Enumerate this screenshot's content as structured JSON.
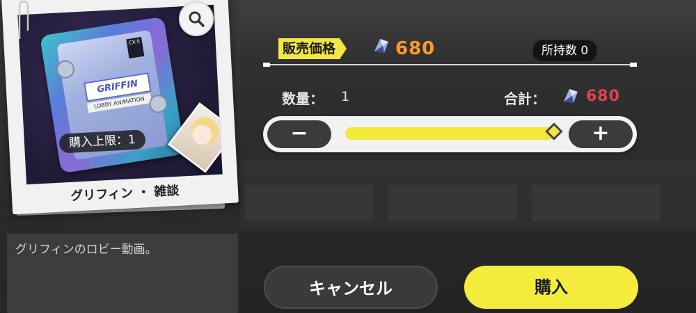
{
  "item": {
    "purchase_limit": "購入上限：1",
    "name": "グリフィン ・ 雑談",
    "description": "グリフィンのロビー動画。",
    "device_label": "GRIFFIN",
    "device_sublabel": "LOBBY ANIMATION",
    "device_tag": "CX-5",
    "icons": {
      "search": "search-icon"
    }
  },
  "purchase": {
    "price_label": "販売価格",
    "price_value": "680",
    "currency_icon": "crystal-gem-icon",
    "owned_label": "所持数 0",
    "quantity_label": "数量：",
    "quantity_value": "1",
    "total_label": "合計：",
    "total_value": "680",
    "slider_fraction": 1.0,
    "minus_label": "−",
    "plus_label": "+",
    "cancel_label": "キャンセル",
    "buy_label": "購入"
  },
  "colors": {
    "accent_yellow": "#f3ec3d",
    "price_orange": "#ff9a2a",
    "total_red": "#e0434b"
  }
}
